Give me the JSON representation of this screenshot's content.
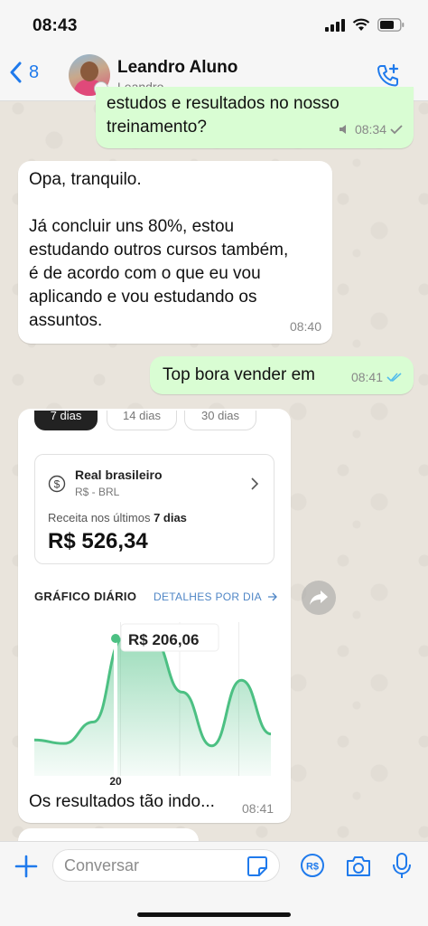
{
  "status": {
    "time": "08:43"
  },
  "header": {
    "back_count": "8",
    "contact_name": "Leandro Aluno",
    "contact_subtitle": "Leandro"
  },
  "messages": [
    {
      "direction": "out",
      "text": "estudos e resultados no nosso\ntreinamento?",
      "time": "08:34",
      "ticks": "single"
    },
    {
      "direction": "in",
      "text": "Opa, tranquilo.\n\nJá concluir uns 80%, estou\nestudando outros cursos também,\né de acordo com o que eu vou\naplicando e vou estudando os\nassuntos.",
      "time": "08:40"
    },
    {
      "direction": "out",
      "text": "Top bora vender em",
      "time": "08:41",
      "ticks": "double-read"
    },
    {
      "direction": "in",
      "text": "Os resultados tão indo...",
      "time": "08:41"
    }
  ],
  "screenshot": {
    "tabs": [
      "7 dias",
      "14 dias",
      "30 dias"
    ],
    "currency_name": "Real brasileiro",
    "currency_code": "R$ - BRL",
    "revenue_label_prefix": "Receita nos últimos ",
    "revenue_label_bold": "7 dias",
    "revenue_value": "R$ 526,34",
    "chart_title": "GRÁFICO DIÁRIO",
    "chart_link": "DETALHES POR DIA",
    "tooltip_value": "R$ 206,06",
    "x_label": "20"
  },
  "chart_data": {
    "type": "area",
    "title": "GRÁFICO DIÁRIO",
    "x_tick_labels": [
      "20"
    ],
    "highlighted": {
      "x_label": "20",
      "value_label": "R$ 206,06"
    },
    "relative_values": [
      0.15,
      0.12,
      0.3,
      1.0,
      1.0,
      0.55,
      0.1,
      0.65,
      0.2
    ],
    "line_color": "#4cc083"
  },
  "composer": {
    "placeholder": "Conversar"
  },
  "colors": {
    "accent": "#1f7aec",
    "outgoing": "#d9fdd3",
    "incoming": "#ffffff",
    "read_ticks": "#53bdeb"
  }
}
